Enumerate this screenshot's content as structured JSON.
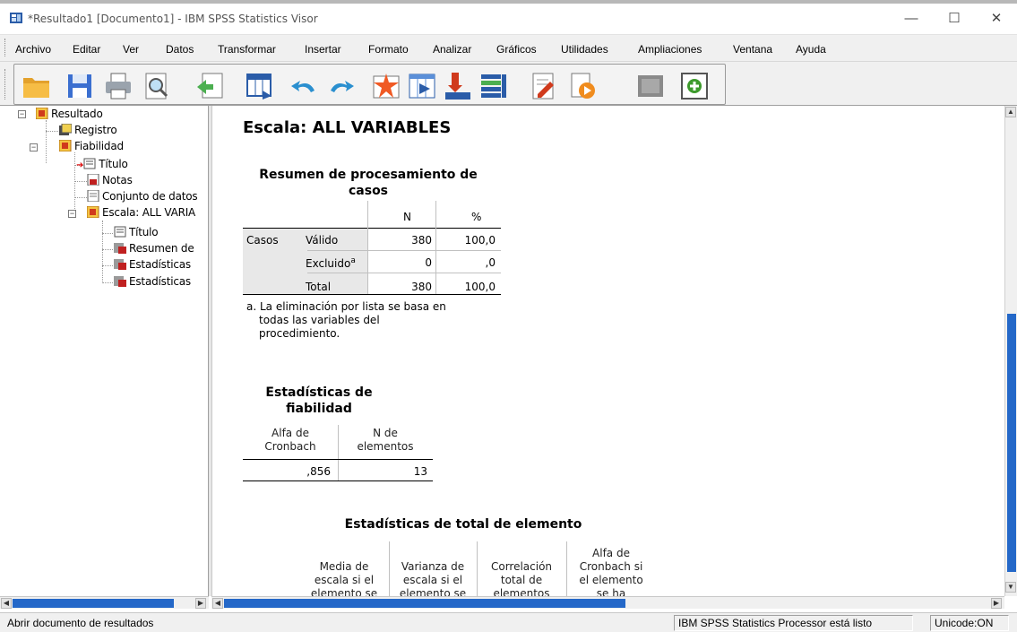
{
  "window": {
    "title": "*Resultado1 [Documento1] - IBM SPSS Statistics Visor",
    "minimize": "—",
    "maximize": "☐",
    "close": "✕"
  },
  "menu": [
    {
      "label": "Archivo"
    },
    {
      "label": "Editar"
    },
    {
      "label": "Ver"
    },
    {
      "label": "Datos"
    },
    {
      "label": "Transformar"
    },
    {
      "label": "Insertar"
    },
    {
      "label": "Formato"
    },
    {
      "label": "Analizar"
    },
    {
      "label": "Gráficos"
    },
    {
      "label": "Utilidades"
    },
    {
      "label": "Ampliaciones"
    },
    {
      "label": "Ventana"
    },
    {
      "label": "Ayuda"
    }
  ],
  "toolbar_icons": [
    "open-icon",
    "save-icon",
    "print-icon",
    "print-preview-icon",
    "export-icon",
    "goto-data-icon",
    "undo-icon",
    "redo-icon",
    "goto-case-icon",
    "goto-variable-icon",
    "insert-variable-icon",
    "insert-cases-icon",
    "designate-window-icon",
    "edit-icon",
    "run-icon",
    "hide-icon",
    "add-icon"
  ],
  "outline": {
    "root": "Resultado",
    "registro": "Registro",
    "fiabilidad": "Fiabilidad",
    "titulo": "Título",
    "notas": "Notas",
    "conjunto": "Conjunto de datos",
    "escala": "Escala: ALL VARIA",
    "titulo2": "Título",
    "resumen": "Resumen de",
    "estadisticas1": "Estadísticas",
    "estadisticas2": "Estadísticas"
  },
  "content": {
    "heading": "Escala: ALL VARIABLES",
    "t1": {
      "title_line1": "Resumen de procesamiento de",
      "title_line2": "casos",
      "col_n": "N",
      "col_pct": "%",
      "row_group": "Casos",
      "rows": [
        {
          "label": "Válido",
          "sup": "",
          "n": "380",
          "pct": "100,0"
        },
        {
          "label": "Excluido",
          "sup": "a",
          "n": "0",
          "pct": ",0"
        },
        {
          "label": "Total",
          "sup": "",
          "n": "380",
          "pct": "100,0"
        }
      ],
      "note_line1": "a. La eliminación por lista se basa en",
      "note_line2": "todas las variables del",
      "note_line3": "procedimiento."
    },
    "t2": {
      "title_line1": "Estadísticas de",
      "title_line2": "fiabilidad",
      "col1_line1": "Alfa de",
      "col1_line2": "Cronbach",
      "col2_line1": "N de",
      "col2_line2": "elementos",
      "alpha": ",856",
      "n_items": "13"
    },
    "t3": {
      "title": "Estadísticas de total de elemento",
      "c1": [
        "Media de",
        "escala si el",
        "elemento se"
      ],
      "c2": [
        "Varianza de",
        "escala si el",
        "elemento se"
      ],
      "c3": [
        "Correlación",
        "total de",
        "elementos"
      ],
      "c4": [
        "Alfa de",
        "Cronbach si",
        "el elemento",
        "se ha"
      ]
    }
  },
  "status": {
    "left": "Abrir documento de resultados",
    "processor": "IBM SPSS Statistics Processor está listo",
    "unicode": "Unicode:ON"
  }
}
